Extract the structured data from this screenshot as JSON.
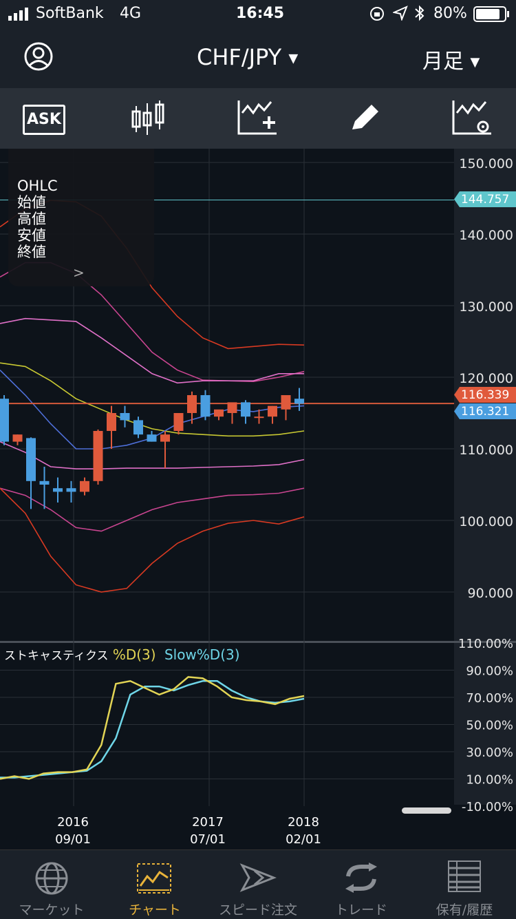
{
  "status_bar": {
    "carrier": "SoftBank",
    "network": "4G",
    "time": "16:45",
    "battery": "80%"
  },
  "nav": {
    "pair": "CHF/JPY",
    "period": "月足"
  },
  "toolbar": {
    "ask_label": "ASK"
  },
  "ohlc_panel": {
    "title": "OHLC",
    "rows": [
      "始値",
      "高値",
      "安値",
      "終値"
    ]
  },
  "price_axis": {
    "ticks": [
      "150.000",
      "140.000",
      "130.000",
      "120.000",
      "110.000",
      "100.000",
      "90.000"
    ],
    "tags": {
      "high_line": "144.757",
      "bid": "116.339",
      "ask": "116.321"
    }
  },
  "oscillator": {
    "title": "ストキャスティクス",
    "series_d": "%D(3)",
    "series_slow": "Slow%D(3)",
    "ticks": [
      "110.00%",
      "90.00%",
      "70.00%",
      "50.00%",
      "30.00%",
      "10.00%",
      "-10.00%"
    ]
  },
  "time_axis": [
    {
      "year": "2016",
      "date": "09/01"
    },
    {
      "year": "2017",
      "date": "07/01"
    },
    {
      "year": "2018",
      "date": "02/01"
    }
  ],
  "tabs": [
    {
      "label": "マーケット",
      "icon": "globe-icon"
    },
    {
      "label": "チャート",
      "icon": "chart-icon"
    },
    {
      "label": "スピード注文",
      "icon": "speed-order-icon"
    },
    {
      "label": "トレード",
      "icon": "trade-refresh-icon"
    },
    {
      "label": "保有/履歴",
      "icon": "history-list-icon"
    }
  ],
  "colors": {
    "up_candle": "#e05a3c",
    "down_candle": "#4a9ee0",
    "accent": "#e8b33a",
    "price_line": "#d55a3a",
    "slow_line": "#6fd6e8",
    "d_line": "#e2d455"
  },
  "chart_data": {
    "type": "candlestick",
    "ylim": [
      88,
      152
    ],
    "candles": [
      {
        "o": 117,
        "h": 117.5,
        "c": 111,
        "l": 110.5
      },
      {
        "o": 111,
        "h": 112,
        "c": 112,
        "l": 110.5
      },
      {
        "o": 111.5,
        "h": 111.6,
        "c": 105.5,
        "l": 101.6
      },
      {
        "o": 105.5,
        "h": 107.5,
        "c": 105,
        "l": 101.6
      },
      {
        "o": 104.5,
        "h": 106,
        "c": 104,
        "l": 102.5
      },
      {
        "o": 104.5,
        "h": 105.5,
        "c": 104,
        "l": 102.5
      },
      {
        "o": 104,
        "h": 106,
        "c": 105.5,
        "l": 103.5
      },
      {
        "o": 105.5,
        "h": 112.7,
        "c": 112.5,
        "l": 105
      },
      {
        "o": 112.5,
        "h": 116,
        "c": 115,
        "l": 110
      },
      {
        "o": 115,
        "h": 116,
        "c": 114,
        "l": 113
      },
      {
        "o": 114,
        "h": 114.5,
        "c": 112,
        "l": 111.5
      },
      {
        "o": 112,
        "h": 112.5,
        "c": 111,
        "l": 111
      },
      {
        "o": 111,
        "h": 112.5,
        "c": 112,
        "l": 107.3
      },
      {
        "o": 112.5,
        "h": 115,
        "c": 115,
        "l": 112
      },
      {
        "o": 115,
        "h": 118,
        "c": 117.5,
        "l": 113.5
      },
      {
        "o": 117.5,
        "h": 118.2,
        "c": 114.5,
        "l": 114
      },
      {
        "o": 114.5,
        "h": 115,
        "c": 115.5,
        "l": 114
      },
      {
        "o": 115,
        "h": 116,
        "c": 116.5,
        "l": 113.5
      },
      {
        "o": 116.5,
        "h": 116.8,
        "c": 114.5,
        "l": 113.5
      },
      {
        "o": 114.5,
        "h": 115.5,
        "c": 114.5,
        "l": 113.5
      },
      {
        "o": 114.5,
        "h": 116,
        "c": 116,
        "l": 113.5
      },
      {
        "o": 115.5,
        "h": 117.5,
        "c": 117.5,
        "l": 114
      },
      {
        "o": 117,
        "h": 118.5,
        "c": 116.3,
        "l": 115.3
      }
    ],
    "indicator_lines": [
      {
        "name": "upper-3sigma",
        "color": "#d93a22",
        "values": [
          141,
          143.5,
          144.7,
          144.5,
          142.5,
          138,
          132.5,
          128.5,
          125.5,
          124,
          124.3,
          124.6,
          124.5
        ]
      },
      {
        "name": "upper-2sigma",
        "color": "#c94590",
        "values": [
          134,
          136,
          136,
          134.5,
          131.5,
          127.5,
          123.5,
          121,
          119.6,
          119.5,
          119.4,
          120,
          120.8
        ]
      },
      {
        "name": "upper-1sigma",
        "color": "#e070c8",
        "values": [
          127.5,
          128.2,
          128,
          127.8,
          125.5,
          123,
          120.5,
          119.2,
          119.5,
          119.5,
          119.5,
          120.5,
          120.5
        ]
      },
      {
        "name": "middle-sma",
        "color": "#c8c832",
        "values": [
          122,
          121.5,
          119.5,
          117,
          115.5,
          114,
          112.8,
          112.2,
          112,
          111.8,
          111.8,
          112,
          112.5
        ]
      },
      {
        "name": "ema",
        "color": "#4e6fd8",
        "values": [
          121,
          117.5,
          113.5,
          110,
          110,
          110.5,
          111.5,
          113.5,
          114.5,
          115.5,
          115.2,
          115.8,
          116
        ]
      },
      {
        "name": "lower-1sigma",
        "color": "#e070c8",
        "values": [
          111,
          109.5,
          107.5,
          107.2,
          107.2,
          107.3,
          107.3,
          107.3,
          107.4,
          107.5,
          107.6,
          107.8,
          108.5
        ]
      },
      {
        "name": "lower-2sigma",
        "color": "#c94590",
        "values": [
          104.5,
          103.5,
          101.5,
          99,
          98.5,
          100,
          101.5,
          102.5,
          103,
          103.5,
          103.6,
          103.8,
          104.5
        ]
      },
      {
        "name": "lower-3sigma",
        "color": "#d93a22",
        "values": [
          104.5,
          101,
          95,
          91,
          90,
          90.5,
          94,
          96.8,
          98.5,
          99.6,
          100,
          99.5,
          100.5
        ]
      }
    ],
    "stochastic_d": [
      10,
      12,
      10,
      14,
      15,
      15,
      17,
      35,
      80,
      82,
      77,
      72,
      76,
      85,
      84,
      78,
      70,
      68,
      67,
      65,
      69,
      71
    ],
    "stochastic_slow": [
      11,
      11,
      12,
      13,
      14,
      15,
      16,
      23,
      40,
      72,
      78,
      78,
      75,
      79,
      82,
      82,
      75,
      70,
      67,
      66,
      67,
      69
    ]
  }
}
